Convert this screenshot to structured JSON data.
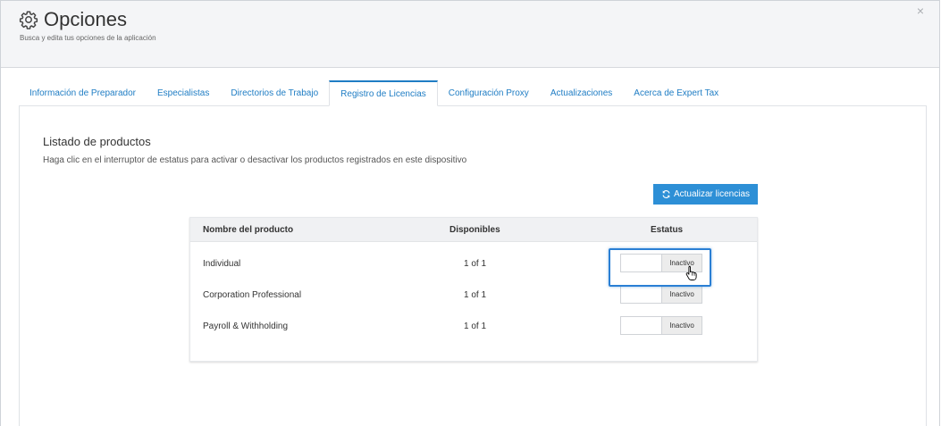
{
  "header": {
    "title": "Opciones",
    "subtitle": "Busca y edita tus opciones de la aplicación",
    "close": "×"
  },
  "tabs": [
    {
      "label": "Información de Preparador",
      "active": false
    },
    {
      "label": "Especialistas",
      "active": false
    },
    {
      "label": "Directorios de Trabajo",
      "active": false
    },
    {
      "label": "Registro de Licencias",
      "active": true
    },
    {
      "label": "Configuración Proxy",
      "active": false
    },
    {
      "label": "Actualizaciones",
      "active": false
    },
    {
      "label": "Acerca de Expert Tax",
      "active": false
    }
  ],
  "section": {
    "title": "Listado de productos",
    "description": "Haga clic en el interruptor de estatus para activar o desactivar los productos registrados en este dispositivo"
  },
  "refresh_button": {
    "label": "Actualizar licencias",
    "icon": "refresh-icon"
  },
  "table": {
    "columns": [
      "Nombre del producto",
      "Disponibles",
      "Estatus"
    ],
    "rows": [
      {
        "name": "Individual",
        "available": "1 of 1",
        "status": "Inactivo"
      },
      {
        "name": "Corporation Professional",
        "available": "1 of 1",
        "status": "Inactivo"
      },
      {
        "name": "Payroll & Withholding",
        "available": "1 of 1",
        "status": "Inactivo"
      }
    ]
  },
  "colors": {
    "accent": "#1f7dc4",
    "button": "#2d8fd6",
    "highlight": "#2a7fd4",
    "header_bg": "#f4f5f7"
  }
}
